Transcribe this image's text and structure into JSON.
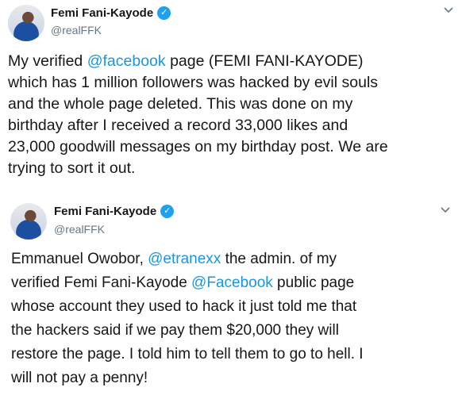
{
  "tweets": [
    {
      "display_name": "Femi Fani-Kayode",
      "handle": "@realFFK",
      "verified": true,
      "body": {
        "lines": [
          [
            {
              "t": "My verified ",
              "m": false
            },
            {
              "t": "@facebook",
              "m": true
            },
            {
              "t": " page (FEMI FANI-KAYODE)",
              "m": false
            }
          ],
          [
            {
              "t": "which has 1 million followers was hacked by evil souls",
              "m": false
            }
          ],
          [
            {
              "t": "and the whole page deleted. This was done on my",
              "m": false
            }
          ],
          [
            {
              "t": "birthday after I received a record 33,000 likes and",
              "m": false
            }
          ],
          [
            {
              "t": "23,000 goodwill messages on my birthday post. We are",
              "m": false
            }
          ],
          [
            {
              "t": "trying to sort it out.",
              "m": false
            }
          ]
        ]
      }
    },
    {
      "display_name": "Femi Fani-Kayode",
      "handle": "@realFFK",
      "verified": true,
      "body": {
        "lines": [
          [
            {
              "t": "Emmanuel Owobor, ",
              "m": false
            },
            {
              "t": "@etranexx",
              "m": true
            },
            {
              "t": " the admin. of my",
              "m": false
            }
          ],
          [
            {
              "t": "verified Femi Fani-Kayode ",
              "m": false
            },
            {
              "t": "@Facebook",
              "m": true
            },
            {
              "t": " public page",
              "m": false
            }
          ],
          [
            {
              "t": "whose account they used to hack it just told me that",
              "m": false
            }
          ],
          [
            {
              "t": "the hackers said if we pay them $20,000 they will",
              "m": false
            }
          ],
          [
            {
              "t": "restore the page. I told him to tell them to go to hell. I",
              "m": false
            }
          ],
          [
            {
              "t": "will not pay a penny!",
              "m": false
            }
          ]
        ]
      }
    }
  ],
  "colors": {
    "mention": "#1b95e0",
    "verified_badge": "#1da1f2",
    "handle": "#657786",
    "text": "#14171a"
  },
  "icons": {
    "verified": "verified-badge-icon",
    "caret": "chevron-down-icon"
  }
}
